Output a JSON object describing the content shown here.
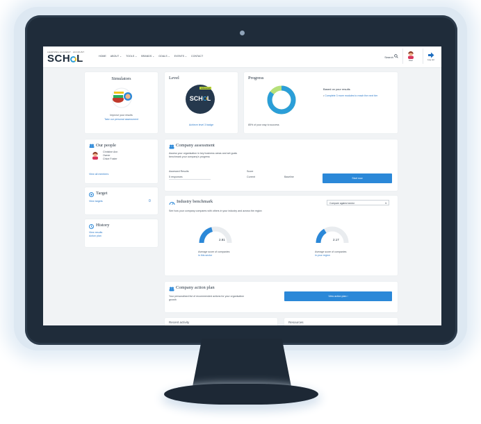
{
  "nav": {
    "logo_small": "LEARNING ACADEMY · ACCOUNT",
    "logo": "SCH",
    "logo_end": "L",
    "menu": [
      "HOME",
      "ABOUT ⌄",
      "TOOLS ⌄",
      "BRANDS ⌄",
      "GOALS ⌄",
      "EVENTS ⌄",
      "CONTACT"
    ],
    "search_label": "Search",
    "profile_label": "User",
    "logout_label": "Log out"
  },
  "sidebar": {
    "simulators_title": "Simulators",
    "simulators_text": "Improve your results",
    "simulators_link": "Take our personal assessment",
    "people_title": "Our people",
    "people_lines": [
      "Christine Ann",
      "Owner",
      "Chloe Foster"
    ],
    "people_link": "View all members",
    "target_title": "Target",
    "target_link": "View targets",
    "target_count": "0",
    "history_title": "History",
    "history_links": [
      "View results",
      "Action plan"
    ]
  },
  "level": {
    "title": "Level",
    "badge_tag": "Advanced",
    "badge_text": "SCH",
    "badge_end": "L",
    "caption": "Achieve level 3 badge"
  },
  "progress": {
    "title": "Progress",
    "value": 85,
    "caption": "85% of your way to success",
    "side_heading": "Based on your results",
    "side_text": "Complete 3 more modules to reach the next tier",
    "colors": {
      "done": "#2b9ed8",
      "rest": "#b6e07a"
    }
  },
  "assessment": {
    "title": "Company assessment",
    "desc_line1": "Assess your organisation in key business areas and set goals",
    "desc_line2": "benchmark your company's progress",
    "col1_label": "Assessed Results",
    "col1_value": "5 responses",
    "col2_label": "Score",
    "col2_value": "Current",
    "col3_value": "Baseline",
    "button": "Start now"
  },
  "benchmark": {
    "title": "Industry benchmark",
    "select_value": "Compare against sector",
    "desc": "See how your company compares with others in your industry and across the region",
    "gauges": [
      {
        "value_label": "2.81",
        "caption1": "Average score of companies",
        "caption2": "in this sector",
        "fill": 0.42
      },
      {
        "value_label": "2.17",
        "caption1": "Average score of companies",
        "caption2": "in your region",
        "fill": 0.33
      }
    ]
  },
  "action_plan": {
    "title": "Company action plan",
    "desc_line1": "Your personalised list of recommended actions for your organisation",
    "desc_line2": "growth",
    "button": "View action plan  ›"
  },
  "bottom_cards": [
    "Recent activity",
    "Resources"
  ]
}
